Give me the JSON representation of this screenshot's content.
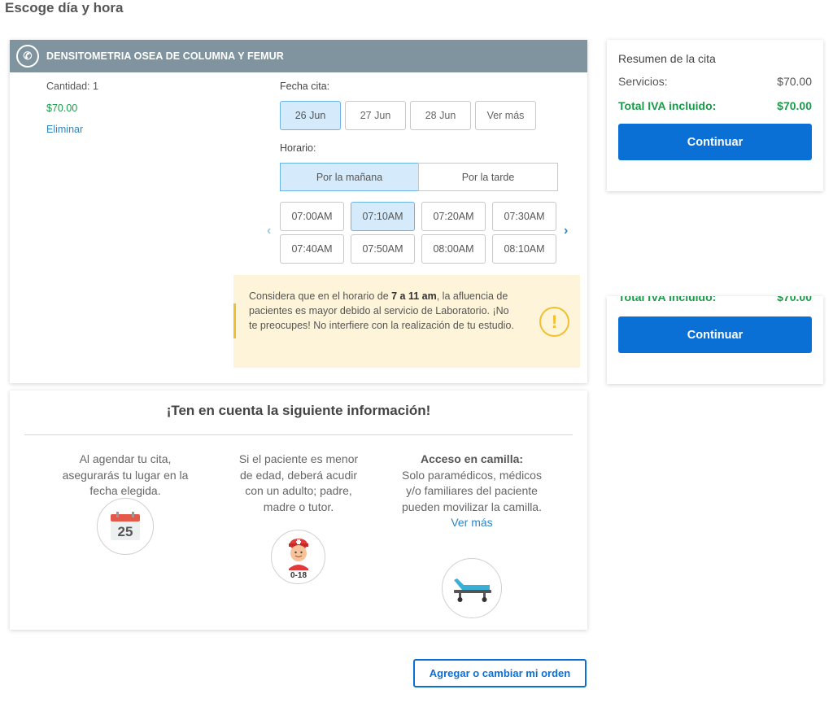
{
  "page_title": "Escoge día y hora",
  "service": {
    "name": "DENSITOMETRIA OSEA DE COLUMNA Y FEMUR",
    "quantity": "Cantidad: 1",
    "price": "$70.00",
    "remove_label": "Eliminar"
  },
  "date_section": {
    "label": "Fecha cita:",
    "dates": [
      "26 Jun",
      "27 Jun",
      "28 Jun"
    ],
    "more_label": "Ver más",
    "selected": "26 Jun"
  },
  "schedule_section": {
    "label": "Horario:",
    "morning_label": "Por la mañana",
    "afternoon_label": "Por la tarde",
    "selected_period": "Por la mañana",
    "times": [
      "07:00AM",
      "07:10AM",
      "07:20AM",
      "07:30AM",
      "07:40AM",
      "07:50AM",
      "08:00AM",
      "08:10AM"
    ],
    "selected_time": "07:10AM",
    "prev_arrow": "‹",
    "next_arrow": "›"
  },
  "notice": {
    "text_before": "Considera que en el horario de ",
    "text_bold": "7 a 11 am",
    "text_after": ", la afluencia de pacientes es mayor debido al servicio de Laboratorio. ¡No te preocupes! No interfiere con la realización de tu estudio.",
    "icon": "!"
  },
  "info": {
    "title": "¡Ten en cuenta la siguiente información!",
    "col1_text": "Al agendar tu cita, asegurarás tu lugar en la fecha elegida.",
    "calendar_day": "25",
    "col2_text": "Si el paciente es menor de edad, deberá acudir con un adulto; padre, madre o tutor.",
    "age_label": "0-18",
    "col3_title": "Acceso en camilla:",
    "col3_text": "Solo paramédicos, médicos y/o familiares del paciente pueden movilizar la camilla.",
    "col3_link": "Ver más"
  },
  "summary": {
    "title": "Resumen de la cita",
    "services_label": "Servicios:",
    "services_value": "$70.00",
    "total_label": "Total IVA incluido:",
    "total_value": "$70.00",
    "continue_label": "Continuar"
  },
  "order_button_label": "Agregar o cambiar mi orden",
  "colors": {
    "header_bg": "#7f949f",
    "primary": "#0a70d6",
    "green": "#1a9a4a",
    "selected_bg": "#d5ebfc",
    "notice_bg": "#fdf4da",
    "warning": "#f0c030"
  }
}
